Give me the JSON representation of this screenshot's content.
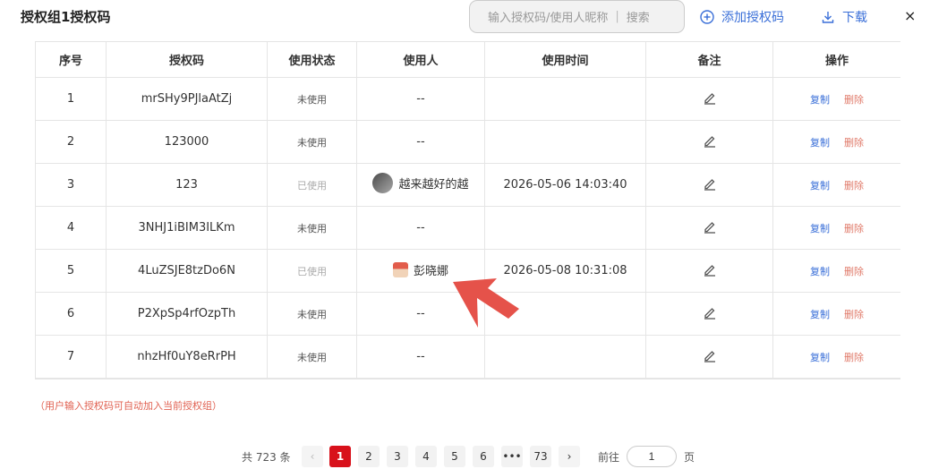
{
  "header": {
    "title": "授权组1授权码",
    "search_placeholder": "输入授权码/使用人昵称",
    "search_label": "搜索",
    "add_label": "添加授权码",
    "download_label": "下载",
    "close_label": "×"
  },
  "table": {
    "columns": [
      "序号",
      "授权码",
      "使用状态",
      "使用人",
      "使用时间",
      "备注",
      "操作"
    ],
    "rows": [
      {
        "index": "1",
        "code": "mrSHy9PJlaAtZj",
        "status": "未使用",
        "user": "--",
        "time": "",
        "copy": "复制",
        "delete": "删除"
      },
      {
        "index": "2",
        "code": "123000",
        "status": "未使用",
        "user": "--",
        "time": "",
        "copy": "复制",
        "delete": "删除"
      },
      {
        "index": "3",
        "code": "123",
        "status": "已使用",
        "user": "越来越好的越",
        "time": "2026-05-06 14:03:40",
        "copy": "复制",
        "delete": "删除"
      },
      {
        "index": "4",
        "code": "3NHJ1iBIM3ILKm",
        "status": "未使用",
        "user": "--",
        "time": "",
        "copy": "复制",
        "delete": "删除"
      },
      {
        "index": "5",
        "code": "4LuZSJE8tzDo6N",
        "status": "已使用",
        "user": "彭晓娜",
        "time": "2026-05-08 10:31:08",
        "copy": "复制",
        "delete": "删除"
      },
      {
        "index": "6",
        "code": "P2XpSp4rfOzpTh",
        "status": "未使用",
        "user": "--",
        "time": "",
        "copy": "复制",
        "delete": "删除"
      },
      {
        "index": "7",
        "code": "nhzHf0uY8eRrPH",
        "status": "未使用",
        "user": "--",
        "time": "",
        "copy": "复制",
        "delete": "删除"
      }
    ]
  },
  "hint": "（用户输入授权码可自动加入当前授权组）",
  "pagination": {
    "total_text": "共 723 条",
    "prev": "‹",
    "next": "›",
    "pages": [
      "1",
      "2",
      "3",
      "4",
      "5",
      "6",
      "•••",
      "73"
    ],
    "active_page": "1",
    "goto_label": "前往",
    "goto_value": "1",
    "page_suffix": "页"
  },
  "colors": {
    "accent": "#3a6fd8",
    "active_page": "#d8111b",
    "delete": "#e07a6a",
    "hint": "#e06050",
    "annotation_arrow": "#e5524a"
  },
  "icons": [
    "add-circle-icon",
    "download-icon",
    "close-icon",
    "edit-icon",
    "annotation-arrow-icon"
  ]
}
